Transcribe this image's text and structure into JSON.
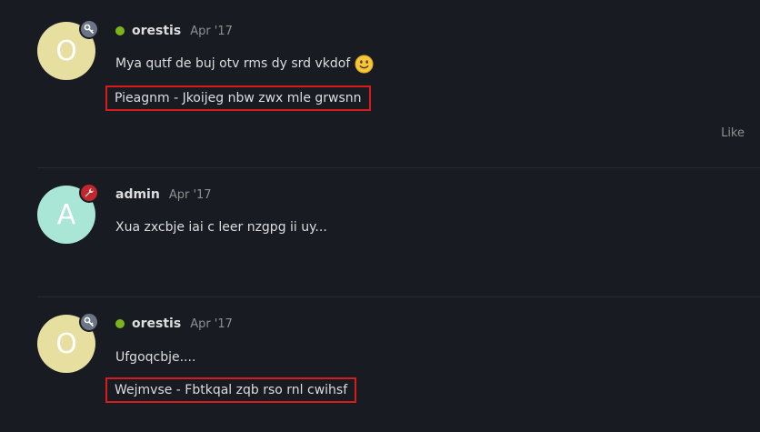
{
  "posts": [
    {
      "avatar_letter": "O",
      "avatar_color": "#e6dfa0",
      "badge_icon": "key-icon",
      "badge_color": "#6b7587",
      "online": true,
      "online_color": "#7ab51d",
      "username": "orestis",
      "date": "Apr '17",
      "text": "Mya qutf de buj otv rms dy srd vkdof",
      "emoji": "slightly-smiling-face-icon",
      "highlighted_text": "Pieagnm - Jkoijeg nbw zwx mle grwsnn",
      "like_label": "Like"
    },
    {
      "avatar_letter": "A",
      "avatar_color": "#a9e6d5",
      "badge_icon": "wrench-icon",
      "badge_color": "#c1272d",
      "online": false,
      "username": "admin",
      "date": "Apr '17",
      "text": "Xua zxcbje iai c leer nzgpg ii uy..."
    },
    {
      "avatar_letter": "O",
      "avatar_color": "#e6dfa0",
      "badge_icon": "key-icon",
      "badge_color": "#6b7587",
      "online": true,
      "online_color": "#7ab51d",
      "username": "orestis",
      "date": "Apr '17",
      "text": "Ufgoqcbje....",
      "highlighted_text": "Wejmvse - Fbtkqal zqb rso rnl cwihsf"
    }
  ],
  "highlight_color": "#d81c1c"
}
